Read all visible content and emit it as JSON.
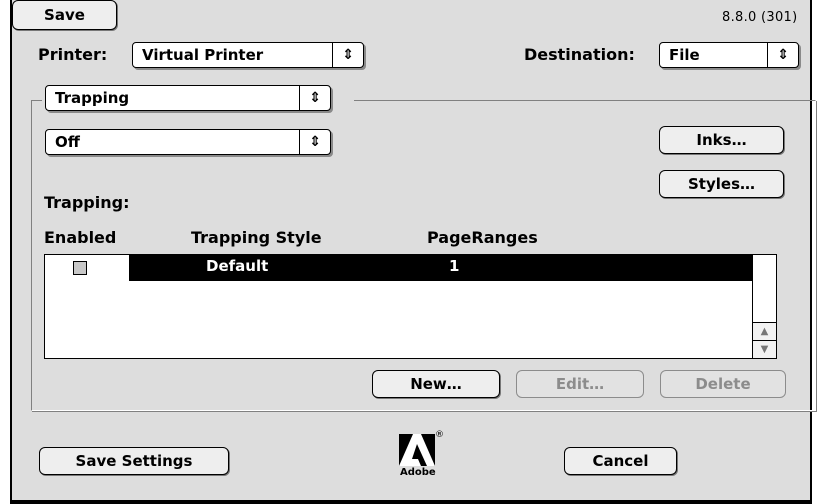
{
  "version": "8.8.0 (301)",
  "printer": {
    "label": "Printer:",
    "value": "Virtual Printer"
  },
  "destination": {
    "label": "Destination:",
    "value": "File"
  },
  "panel_selector": {
    "value": "Trapping"
  },
  "trapping_mode": {
    "value": "Off"
  },
  "buttons": {
    "inks": "Inks…",
    "styles": "Styles…",
    "new": "New…",
    "edit": "Edit…",
    "delete": "Delete",
    "save_settings": "Save Settings",
    "cancel": "Cancel",
    "save": "Save"
  },
  "table": {
    "caption": "Trapping:",
    "headers": [
      "Enabled",
      "Trapping Style",
      "PageRanges"
    ],
    "rows": [
      {
        "enabled": false,
        "style": "Default",
        "pages": "1",
        "selected": true
      }
    ]
  },
  "logo": {
    "text": "Adobe",
    "mark": "®"
  },
  "icons": {
    "popup_arrows": "updown-arrows-icon",
    "scroll_up": "scroll-up-arrow-icon",
    "scroll_down": "scroll-down-arrow-icon",
    "logo": "adobe-logo"
  }
}
